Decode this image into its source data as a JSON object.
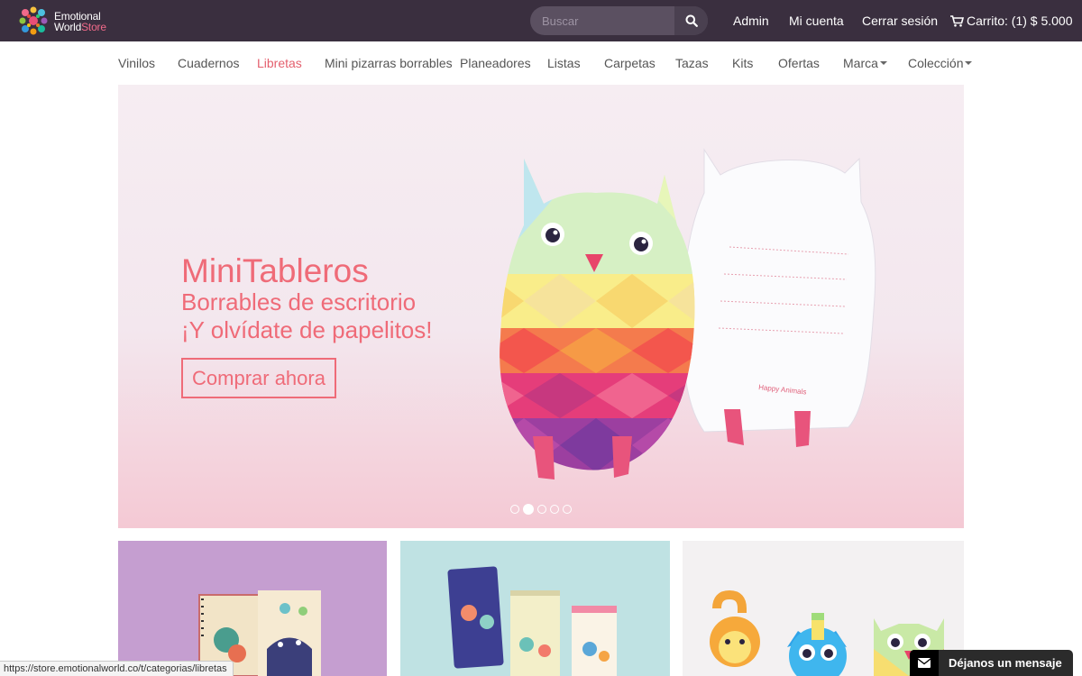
{
  "header": {
    "logo": {
      "line1": "Emotional",
      "line2a": "World",
      "line2b": "Store"
    },
    "search": {
      "placeholder": "Buscar"
    },
    "links": {
      "admin": "Admin",
      "account": "Mi cuenta",
      "logout": "Cerrar sesión",
      "cart": "Carrito: (1) $ 5.000"
    }
  },
  "nav": {
    "items": [
      {
        "label": "Vinilos"
      },
      {
        "label": "Cuadernos"
      },
      {
        "label": "Libretas"
      },
      {
        "label": "Mini pizarras borrables"
      },
      {
        "label": "Planeadores"
      },
      {
        "label": "Listas"
      },
      {
        "label": "Carpetas"
      },
      {
        "label": "Tazas"
      },
      {
        "label": "Kits"
      },
      {
        "label": "Ofertas"
      },
      {
        "label": "Marca"
      },
      {
        "label": "Colección"
      }
    ]
  },
  "hero": {
    "title": "MiniTableros",
    "subtitle1": "Borrables de escritorio",
    "subtitle2": "¡Y olvídate de papelitos!",
    "button": "Comprar ahora",
    "product_text": "Happy Animals",
    "slides_total": 5,
    "active_slide": 2
  },
  "statusbar": {
    "url": "https://store.emotionalworld.co/t/categorias/libretas"
  },
  "message_widget": {
    "label": "Déjanos un mensaje"
  },
  "colors": {
    "topbar": "#3a2f3f",
    "accent": "#ef6b78",
    "active_nav": "#e4606e"
  }
}
